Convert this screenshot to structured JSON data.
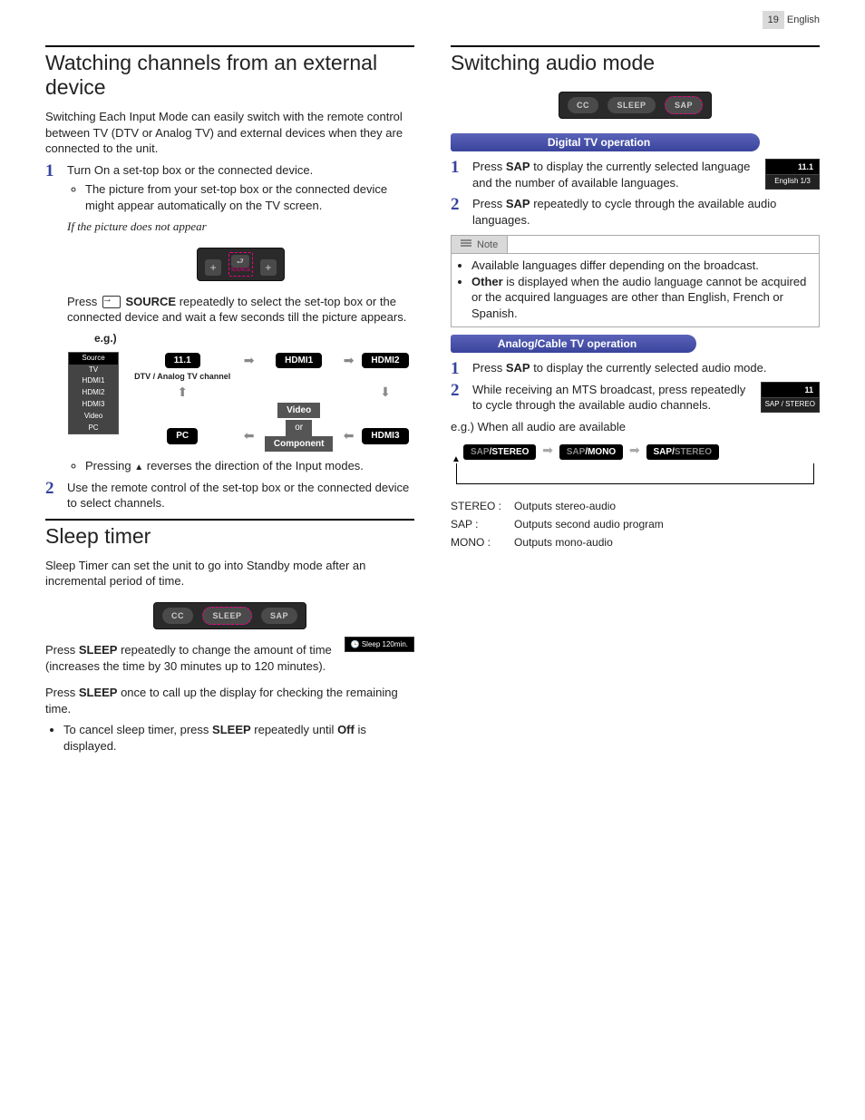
{
  "page_number": "19",
  "page_lang": "English",
  "left": {
    "sec1_title": "Watching channels from an external device",
    "sec1_intro": "Switching Each Input Mode can easily switch with the remote control between TV (DTV or Analog TV) and external devices when they are connected to the unit.",
    "step1": "Turn On a set-top box or the connected device.",
    "step1_bullet": "The picture from your set-top box or the connected device might appear automatically on the TV screen.",
    "if_no_pic": "If the picture does not appear",
    "press": "Press ",
    "source_word": "SOURCE",
    "press_after": " repeatedly to select the set-top box or the connected device and wait a few seconds till the picture appears.",
    "eg": "e.g.)",
    "source_table_header": "Source",
    "source_items": [
      "TV",
      "HDMI1",
      "HDMI2",
      "HDMI3",
      "Video",
      "PC"
    ],
    "node_111": "11.1",
    "node_hdmi1": "HDMI1",
    "node_hdmi2": "HDMI2",
    "node_hdmi3": "HDMI3",
    "node_pc": "PC",
    "node_video": "Video",
    "node_or": "or",
    "node_component": "Component",
    "dtv_label": "DTV / Analog TV channel",
    "cycle_note_pre": "Pressing ",
    "cycle_note_post": " reverses the direction of the Input modes.",
    "step2": "Use the remote control of the set-top box or the connected device to select channels.",
    "sec2_title": "Sleep timer",
    "sec2_intro": "Sleep Timer can set the unit to go into Standby mode after an incremental period of time.",
    "cc_btn": "CC",
    "sleep_btn": "SLEEP",
    "sap_btn": "SAP",
    "sleep_p1a": "Press ",
    "sleep_word": "SLEEP",
    "sleep_p1b": " repeatedly to change the amount of time (increases the time by 30 minutes up to 120 minutes).",
    "osd_sleep": "Sleep           120min.",
    "sleep_p2a": "Press ",
    "sleep_p2b": " once to call up the display for checking the remaining time.",
    "sleep_bullet_a": "To cancel sleep timer, press ",
    "sleep_bullet_b": " repeatedly until ",
    "off_word": "Off",
    "sleep_bullet_c": " is displayed."
  },
  "right": {
    "sec_title": "Switching audio mode",
    "digital_header": "Digital TV operation",
    "d_step1_a": "Press ",
    "sap_word": "SAP",
    "d_step1_b": " to display the currently selected language and the number of available languages.",
    "osd1_top": "11.1",
    "osd1_bot": "English 1/3",
    "d_step2_a": "Press ",
    "d_step2_b": " repeatedly to cycle through the available audio languages.",
    "note_label": "Note",
    "note_items": [
      "Available languages differ depending on the broadcast.",
      "Other is displayed when the audio language cannot be acquired or the acquired languages are other than English, French or Spanish."
    ],
    "note_item2_pre": "",
    "note_item2_bold": "Other",
    "note_item2_post": " is displayed when the audio language cannot be acquired or the acquired languages are other than English, French or Spanish.",
    "analog_header": "Analog/Cable TV operation",
    "a_step1_a": "Press ",
    "a_step1_b": " to display the currently selected audio mode.",
    "a_step2": "While receiving an MTS broadcast, press repeatedly to cycle through the available audio channels.",
    "osd2_top": "11",
    "osd2_bot": "SAP / STEREO",
    "eg_all": "e.g.) When all audio are available",
    "chip1_dim": "SAP",
    "chip1_bold": "/STEREO",
    "chip2_dim": "SAP",
    "chip2_bold": "/MONO",
    "chip3_bold": "SAP/",
    "chip3_dim": "STEREO",
    "defs": [
      {
        "k": "STEREO :",
        "v": "Outputs stereo-audio"
      },
      {
        "k": "SAP :",
        "v": "Outputs second audio program"
      },
      {
        "k": "MONO :",
        "v": "Outputs mono-audio"
      }
    ]
  }
}
